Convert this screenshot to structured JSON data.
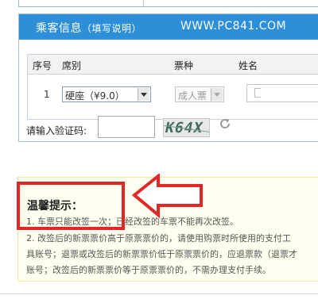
{
  "panel": {
    "title": "乘客信息",
    "subtitle": "（填写说明）",
    "site": "WWW.PC841.COM"
  },
  "table": {
    "headers": [
      "序号",
      "席别",
      "票种",
      "姓名"
    ],
    "row": {
      "index": "1",
      "seat": "硬座（¥9.0）",
      "ticket_type": "成人票"
    }
  },
  "captcha": {
    "label": "请输入验证码:",
    "image_text": "K64X"
  },
  "tips": {
    "title": "温馨提示：",
    "lines": [
      "1. 车票只能改签一次；已经改签的车票不能再次改签。",
      "2. 改签后的新票票价高于原票票价的，请使用购票时所使用的支付工",
      "具账号；退票或改签后的新票票价低于原票票价的，应退票款（退票才",
      "账号；改签后的新票票价等于原票票价的，不需办理支付手续。"
    ]
  },
  "colors": {
    "header_bg": "#2d8fd8",
    "annotation": "#e32727",
    "tips_bg": "#fffff0"
  }
}
